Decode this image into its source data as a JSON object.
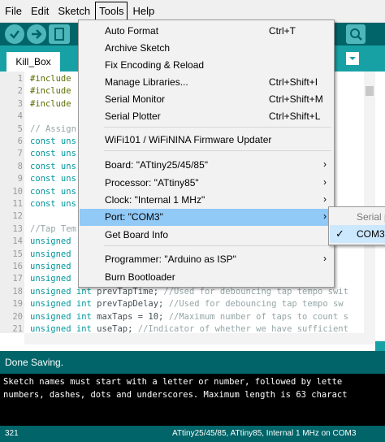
{
  "menubar": {
    "file": "File",
    "edit": "Edit",
    "sketch": "Sketch",
    "tools": "Tools",
    "help": "Help"
  },
  "toolbar": {
    "verify_icon": "check-icon",
    "upload_icon": "arrow-right-icon",
    "new_icon": "page-icon",
    "serial_icon": "magnifier-icon"
  },
  "tab": {
    "label": "Kill_Box"
  },
  "editor": {
    "line_numbers": [
      "1",
      "2",
      "3",
      "4",
      "5",
      "6",
      "7",
      "8",
      "9",
      "10",
      "11",
      "12",
      "13",
      "14",
      "15",
      "16",
      "17",
      "18",
      "19",
      "20",
      "21"
    ],
    "lines": [
      {
        "parts": [
          {
            "t": "#include",
            "c": "pp"
          }
        ]
      },
      {
        "parts": [
          {
            "t": "#include",
            "c": "pp"
          }
        ]
      },
      {
        "parts": [
          {
            "t": "#include",
            "c": "pp"
          }
        ]
      },
      {
        "parts": []
      },
      {
        "parts": [
          {
            "t": "// Assign",
            "c": "cm"
          }
        ]
      },
      {
        "parts": [
          {
            "t": "const uns",
            "c": "kw"
          }
        ]
      },
      {
        "parts": [
          {
            "t": "const uns",
            "c": "kw"
          }
        ]
      },
      {
        "parts": [
          {
            "t": "const uns",
            "c": "kw"
          }
        ]
      },
      {
        "parts": [
          {
            "t": "const uns",
            "c": "kw"
          }
        ]
      },
      {
        "parts": [
          {
            "t": "const uns",
            "c": "kw"
          }
        ]
      },
      {
        "parts": [
          {
            "t": "const uns",
            "c": "kw"
          }
        ]
      },
      {
        "parts": []
      },
      {
        "parts": [
          {
            "t": "//Tap Tem",
            "c": "cm"
          }
        ]
      },
      {
        "parts": [
          {
            "t": "unsigned",
            "c": "kw"
          }
        ]
      },
      {
        "parts": [
          {
            "t": "unsigned",
            "c": "kw"
          }
        ]
      },
      {
        "parts": [
          {
            "t": "unsigned",
            "c": "kw"
          },
          {
            "t": "                                      hecking",
            "c": "cm"
          }
        ]
      },
      {
        "parts": [
          {
            "t": "unsigned",
            "c": "kw"
          }
        ]
      },
      {
        "parts": [
          {
            "t": "unsigned int",
            "c": "kw"
          },
          {
            "t": " prevTapTime; ",
            "c": ""
          },
          {
            "t": "//Used for debouncing tap tempo swit",
            "c": "cm"
          }
        ]
      },
      {
        "parts": [
          {
            "t": "unsigned int",
            "c": "kw"
          },
          {
            "t": " prevTapDelay; ",
            "c": ""
          },
          {
            "t": "//Used for debouncing tap tempo sw",
            "c": "cm"
          }
        ]
      },
      {
        "parts": [
          {
            "t": "unsigned int",
            "c": "kw"
          },
          {
            "t": " maxTaps = 10; ",
            "c": ""
          },
          {
            "t": "//Maximum number of taps to count s",
            "c": "cm"
          }
        ]
      },
      {
        "parts": [
          {
            "t": "unsigned int",
            "c": "kw"
          },
          {
            "t": " useTap; ",
            "c": ""
          },
          {
            "t": "//Indicator of whether we have sufficient",
            "c": "cm"
          }
        ]
      }
    ]
  },
  "tools_menu": {
    "items": [
      {
        "label": "Auto Format",
        "shortcut": "Ctrl+T"
      },
      {
        "label": "Archive Sketch",
        "shortcut": ""
      },
      {
        "label": "Fix Encoding & Reload",
        "shortcut": ""
      },
      {
        "label": "Manage Libraries...",
        "shortcut": "Ctrl+Shift+I"
      },
      {
        "label": "Serial Monitor",
        "shortcut": "Ctrl+Shift+M"
      },
      {
        "label": "Serial Plotter",
        "shortcut": "Ctrl+Shift+L"
      },
      {
        "label": "WiFi101 / WiFiNINA Firmware Updater",
        "shortcut": ""
      },
      {
        "label": "Board: \"ATtiny25/45/85\"",
        "shortcut": "",
        "submenu": true
      },
      {
        "label": "Processor: \"ATtiny85\"",
        "shortcut": "",
        "submenu": true
      },
      {
        "label": "Clock: \"Internal 1 MHz\"",
        "shortcut": "",
        "submenu": true
      },
      {
        "label": "Port: \"COM3\"",
        "shortcut": "",
        "submenu": true,
        "highlighted": true
      },
      {
        "label": "Get Board Info",
        "shortcut": ""
      },
      {
        "label": "Programmer: \"Arduino as ISP\"",
        "shortcut": "",
        "submenu": true
      },
      {
        "label": "Burn Bootloader",
        "shortcut": ""
      }
    ]
  },
  "port_submenu": {
    "header": "Serial p",
    "item": "COM3",
    "checked": true
  },
  "status": {
    "message": "Done Saving.",
    "console_lines": [
      "Sketch names must start with a letter or number, followed by lette",
      "numbers, dashes, dots and underscores. Maximum length is 63 charact"
    ],
    "line_number": "321",
    "board_info": "ATtiny25/45/85, ATtiny85, Internal 1 MHz on COM3"
  },
  "colors": {
    "toolbar": "#006468",
    "tabstrip": "#17a1a5",
    "highlight": "#91c9f7"
  }
}
